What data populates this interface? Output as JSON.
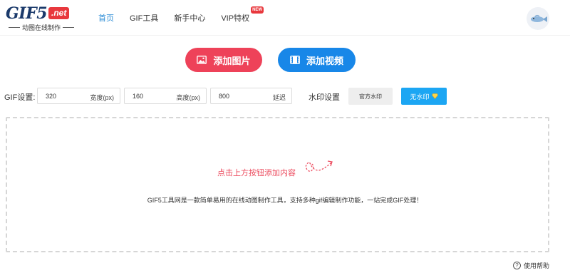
{
  "logo": {
    "main": "GIF5",
    "net": ".net",
    "tagline": "动图在线制作"
  },
  "nav": {
    "items": [
      {
        "label": "首页"
      },
      {
        "label": "GIF工具"
      },
      {
        "label": "新手中心"
      },
      {
        "label": "VIP特权"
      }
    ],
    "active_index": 0,
    "vip_badge": "NEW"
  },
  "actions": {
    "add_image_label": "添加图片",
    "add_video_label": "添加视频"
  },
  "gif_settings": {
    "label": "GIF设置:",
    "width": {
      "value": "320",
      "unit": "宽度(px)"
    },
    "height": {
      "value": "160",
      "unit": "高度(px)"
    },
    "delay": {
      "value": "800",
      "unit": "延迟"
    }
  },
  "watermark": {
    "label": "水印设置",
    "official_label": "官方水印",
    "none_label": "无水印"
  },
  "drop_area": {
    "hint": "点击上方按钮添加内容",
    "description": "GIF5工具网是一款简单易用的在线动图制作工具，支持多种gif编辑制作功能，一站完成GIF处理！"
  },
  "help": {
    "label": "使用帮助"
  },
  "colors": {
    "accent_blue": "#1887e8",
    "accent_red": "#ee4259",
    "nav_active": "#2f8ed6",
    "watermark_none_bg": "#1ca6f3"
  },
  "icons": {
    "add_image": "image-icon",
    "add_video": "film-icon",
    "watermark_none": "diamond-icon",
    "help": "question-icon",
    "hint": "arrow-icon"
  }
}
